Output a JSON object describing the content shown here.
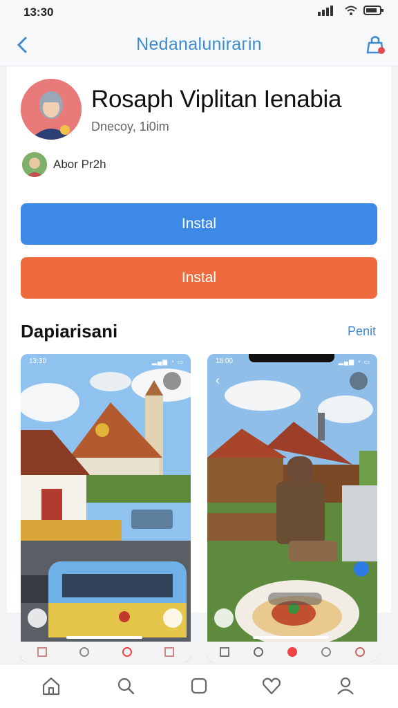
{
  "status_bar": {
    "time": "13:30"
  },
  "header": {
    "title": "Nedanalunirагin"
  },
  "profile": {
    "name": "Rosaph Viplitan Ienabia",
    "meta": "Dnecoy, 1i0im",
    "author": "Abor Pr2h"
  },
  "buttons": {
    "primary": "Instal",
    "secondary": "Instal"
  },
  "section": {
    "title": "Dapiarisani",
    "link": "Penit"
  },
  "screenshots": [
    {
      "time": "13:30"
    },
    {
      "time": "18:00"
    }
  ],
  "icons": {
    "back": "chevron-left-icon",
    "cart": "cart-icon",
    "nav": [
      "home-icon",
      "search-icon",
      "square-icon",
      "heart-icon",
      "profile-icon"
    ]
  },
  "colors": {
    "accent": "#3c8ae6",
    "orange": "#ee6b3f",
    "link": "#3f8bd0"
  }
}
